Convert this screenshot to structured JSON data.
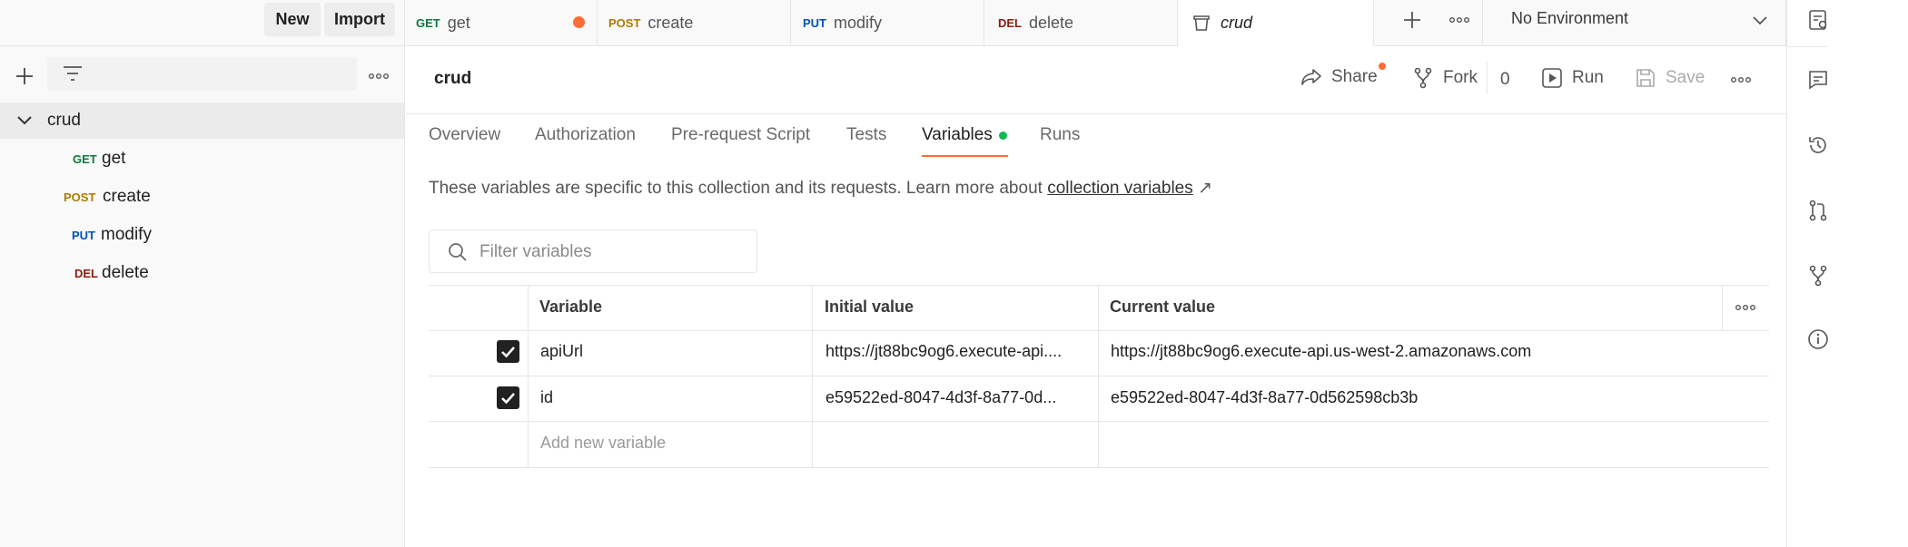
{
  "sidebar": {
    "new_label": "New",
    "import_label": "Import",
    "tree": {
      "collection": "crud",
      "items": [
        {
          "method": "GET",
          "name": "get"
        },
        {
          "method": "POST",
          "name": "create"
        },
        {
          "method": "PUT",
          "name": "modify"
        },
        {
          "method": "DEL",
          "name": "delete"
        }
      ]
    }
  },
  "tabs": [
    {
      "method": "GET",
      "name": "get"
    },
    {
      "method": "POST",
      "name": "create"
    },
    {
      "method": "PUT",
      "name": "modify"
    },
    {
      "method": "DEL",
      "name": "delete"
    },
    {
      "name": "crud"
    }
  ],
  "environment": {
    "selected": "No Environment"
  },
  "header": {
    "title": "crud",
    "share_label": "Share",
    "fork_label": "Fork",
    "fork_count": "0",
    "run_label": "Run",
    "save_label": "Save"
  },
  "nav_tabs": [
    "Overview",
    "Authorization",
    "Pre-request Script",
    "Tests",
    "Variables",
    "Runs"
  ],
  "info": {
    "text": "These variables are specific to this collection and its requests. Learn more about ",
    "link": "collection variables",
    "arrow": "↗"
  },
  "filter": {
    "placeholder": "Filter variables"
  },
  "table": {
    "headers": [
      "Variable",
      "Initial value",
      "Current value"
    ],
    "rows": [
      {
        "variable": "apiUrl",
        "initial": "https://jt88bc9og6.execute-api....",
        "current": "https://jt88bc9og6.execute-api.us-west-2.amazonaws.com"
      },
      {
        "variable": "id",
        "initial": "e59522ed-8047-4d3f-8a77-0d...",
        "current": "e59522ed-8047-4d3f-8a77-0d562598cb3b"
      }
    ],
    "add_placeholder": "Add new variable"
  },
  "colors": {
    "accent": "#ff6c37",
    "active_indicator": "#0cbb52",
    "get": "#0b7b3e",
    "post": "#ad7a03",
    "put": "#0053b8",
    "del": "#8e1a10"
  },
  "icons": [
    "plus-icon",
    "filter-icon",
    "more-icon",
    "chevron-down-icon",
    "collection-icon",
    "share-icon",
    "fork-icon",
    "run-icon",
    "save-icon",
    "search-icon",
    "check-icon",
    "environment-quicklook-icon",
    "comments-icon",
    "history-icon",
    "pull-request-icon",
    "forks-icon",
    "info-icon"
  ]
}
